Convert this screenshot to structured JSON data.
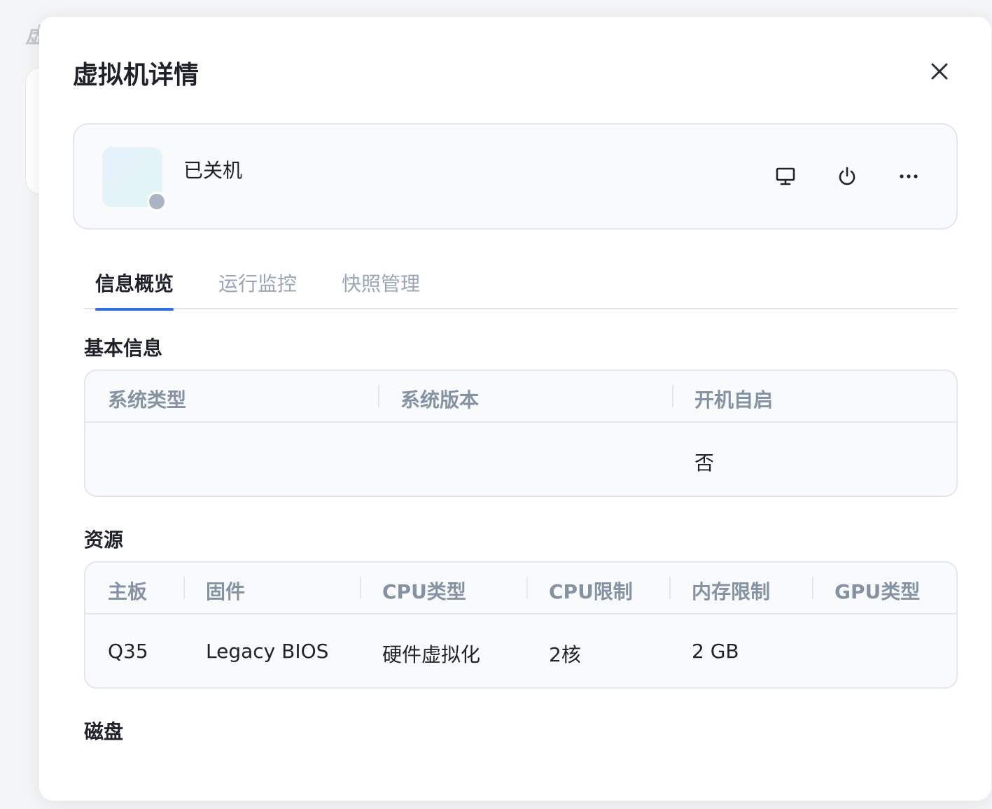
{
  "background": {
    "title_fragment": "虚"
  },
  "modal": {
    "title": "虚拟机详情",
    "close_icon": "close-icon"
  },
  "vm": {
    "status": "已关机",
    "status_color": "#aab4c3",
    "actions": [
      {
        "icon": "monitor-icon"
      },
      {
        "icon": "power-icon"
      },
      {
        "icon": "more-horizontal-icon"
      }
    ]
  },
  "tabs": [
    {
      "label": "信息概览",
      "active": true
    },
    {
      "label": "运行监控",
      "active": false
    },
    {
      "label": "快照管理",
      "active": false
    }
  ],
  "basic_info": {
    "title": "基本信息",
    "headers": [
      "系统类型",
      "系统版本",
      "开机自启"
    ],
    "values": [
      "",
      "",
      "否"
    ]
  },
  "resources": {
    "title": "资源",
    "headers": [
      "主板",
      "固件",
      "CPU类型",
      "CPU限制",
      "内存限制",
      "GPU类型"
    ],
    "values": [
      "Q35",
      "Legacy BIOS",
      "硬件虚拟化",
      "2核",
      "2 GB",
      ""
    ]
  },
  "disk": {
    "title": "磁盘"
  },
  "colors": {
    "accent": "#2f6fe0",
    "text": "#1f2329",
    "muted": "#9aa6b5"
  }
}
